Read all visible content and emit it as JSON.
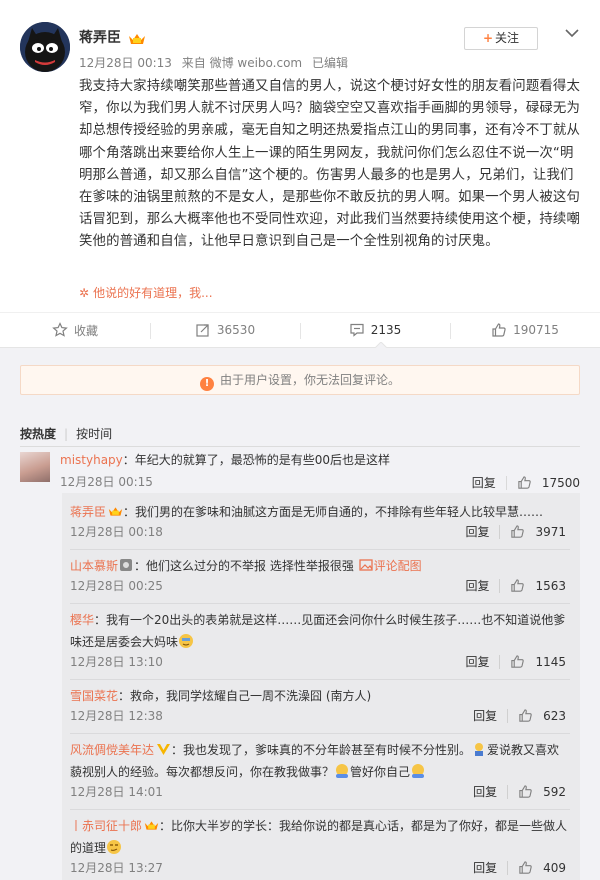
{
  "post": {
    "author": "蒋弄臣",
    "date": "12月28日 00:13",
    "source": "来自 微博 weibo.com",
    "edited": "已编辑",
    "follow_label": "关注",
    "content": "我支持大家持续嘲笑那些普通又自信的男人，说这个梗讨好女性的朋友看问题看得太窄，你以为我们男人就不讨厌男人吗？脑袋空空又喜欢指手画脚的男领导，碌碌无为却总想传授经验的男亲戚，毫无自知之明还热爱指点江山的男同事，还有冷不丁就从哪个角落跳出来要给你人生上一课的陌生男网友，我就问你们怎么忍住不说一次“明明那么普通，却又那么自信”这个梗的。伤害男人最多的也是男人，兄弟们，让我们在爹味的油锅里煎熬的不是女人，是那些你不敢反抗的男人啊。如果一个男人被这句话冒犯到，那么大概率他也不受同性欢迎，对此我们当然要持续使用这个梗，持续嘲笑他的普通和自信，让他早日意识到自己是一个全性别视角的讨厌鬼。",
    "ai_summary": "他说的好有道理，我...",
    "accent_color": "#eb7350"
  },
  "actions": {
    "favorite_label": "收藏",
    "repost_count": "36530",
    "comment_count": "2135",
    "like_count": "190715"
  },
  "comments": {
    "notice": "由于用户设置，你无法回复评论。",
    "sort_hot": "按热度",
    "sort_time": "按时间",
    "reply_label": "回复",
    "main": {
      "user": "mistyhapy",
      "text": "：年纪大的就算了，最恐怖的是有些00后也是这样",
      "time": "12月28日 00:15",
      "likes": "17500"
    },
    "replies": [
      {
        "user": "蒋弄臣",
        "text": "：我们男的在爹味和油腻这方面是无师自通的，不排除有些年轻人比较早慧……",
        "time": "12月28日 00:18",
        "likes": "3971"
      },
      {
        "user": "山本慕斯",
        "text": "：他们这么过分的不举报 选择性举报很强",
        "extra": "评论配图",
        "time": "12月28日 00:25",
        "likes": "1563"
      },
      {
        "user": "樱华",
        "text": "：我有一个20出头的表弟就是这样……见面还会问你什么时候生孩子……也不知道说他爹味还是居委会大妈味",
        "time": "12月28日 13:10",
        "likes": "1145"
      },
      {
        "user": "雪国菜花",
        "text": "：救命，我同学炫耀自己一周不洗澡囧 (南方人)",
        "time": "12月28日 12:38",
        "likes": "623"
      },
      {
        "user": "风流倜傥美年达",
        "text": "：我也发现了，爹味真的不分年龄甚至有时候不分性别。",
        "text2": "爱说教又喜欢藐视别人的经验。每次都想反问，你在教我做事？",
        "text3": "管好你自己",
        "time": "12月28日 14:01",
        "likes": "592"
      },
      {
        "user": "丨赤司征十郎",
        "text": "：比你大半岁的学长：我给你说的都是真心话，都是为了你好，都是一些做人的道理",
        "time": "12月28日 13:27",
        "likes": "409"
      }
    ]
  }
}
